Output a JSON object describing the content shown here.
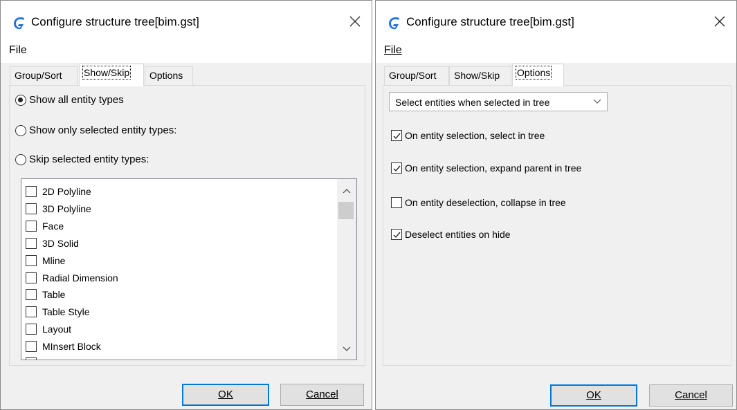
{
  "left_dialog": {
    "title": "Configure structure tree[bim.gst]",
    "menu": {
      "file": "File"
    },
    "tabs": [
      {
        "label": "Group/Sort",
        "active": false
      },
      {
        "label": "Show/Skip",
        "active": true
      },
      {
        "label": "Options",
        "active": false
      }
    ],
    "radios": [
      {
        "label": "Show all entity types",
        "checked": true
      },
      {
        "label": "Show only selected entity types:",
        "checked": false
      },
      {
        "label": "Skip selected entity types:",
        "checked": false
      }
    ],
    "entity_list": [
      {
        "label": "2D Polyline",
        "checked": false
      },
      {
        "label": "3D Polyline",
        "checked": false
      },
      {
        "label": "Face",
        "checked": false
      },
      {
        "label": "3D Solid",
        "checked": false
      },
      {
        "label": "Mline",
        "checked": false
      },
      {
        "label": "Radial Dimension",
        "checked": false
      },
      {
        "label": "Table",
        "checked": false
      },
      {
        "label": "Table Style",
        "checked": false
      },
      {
        "label": "Layout",
        "checked": false
      },
      {
        "label": "MInsert Block",
        "checked": false
      }
    ],
    "ok_label": "OK",
    "cancel_label": "Cancel"
  },
  "right_dialog": {
    "title": "Configure structure tree[bim.gst]",
    "menu": {
      "file": "File"
    },
    "tabs": [
      {
        "label": "Group/Sort",
        "active": false
      },
      {
        "label": "Show/Skip",
        "active": false
      },
      {
        "label": "Options",
        "active": true
      }
    ],
    "select_mode": "Select entities when selected in tree",
    "options": [
      {
        "label": "On entity selection, select in tree",
        "checked": true
      },
      {
        "label": "On entity selection, expand parent in tree",
        "checked": true
      },
      {
        "label": "On entity deselection, collapse in tree",
        "checked": false
      },
      {
        "label": "Deselect entities on hide",
        "checked": true
      }
    ],
    "ok_label": "OK",
    "cancel_label": "Cancel"
  },
  "colors": {
    "app_icon": "#1e73e8",
    "default_button_border": "#0078d7"
  }
}
